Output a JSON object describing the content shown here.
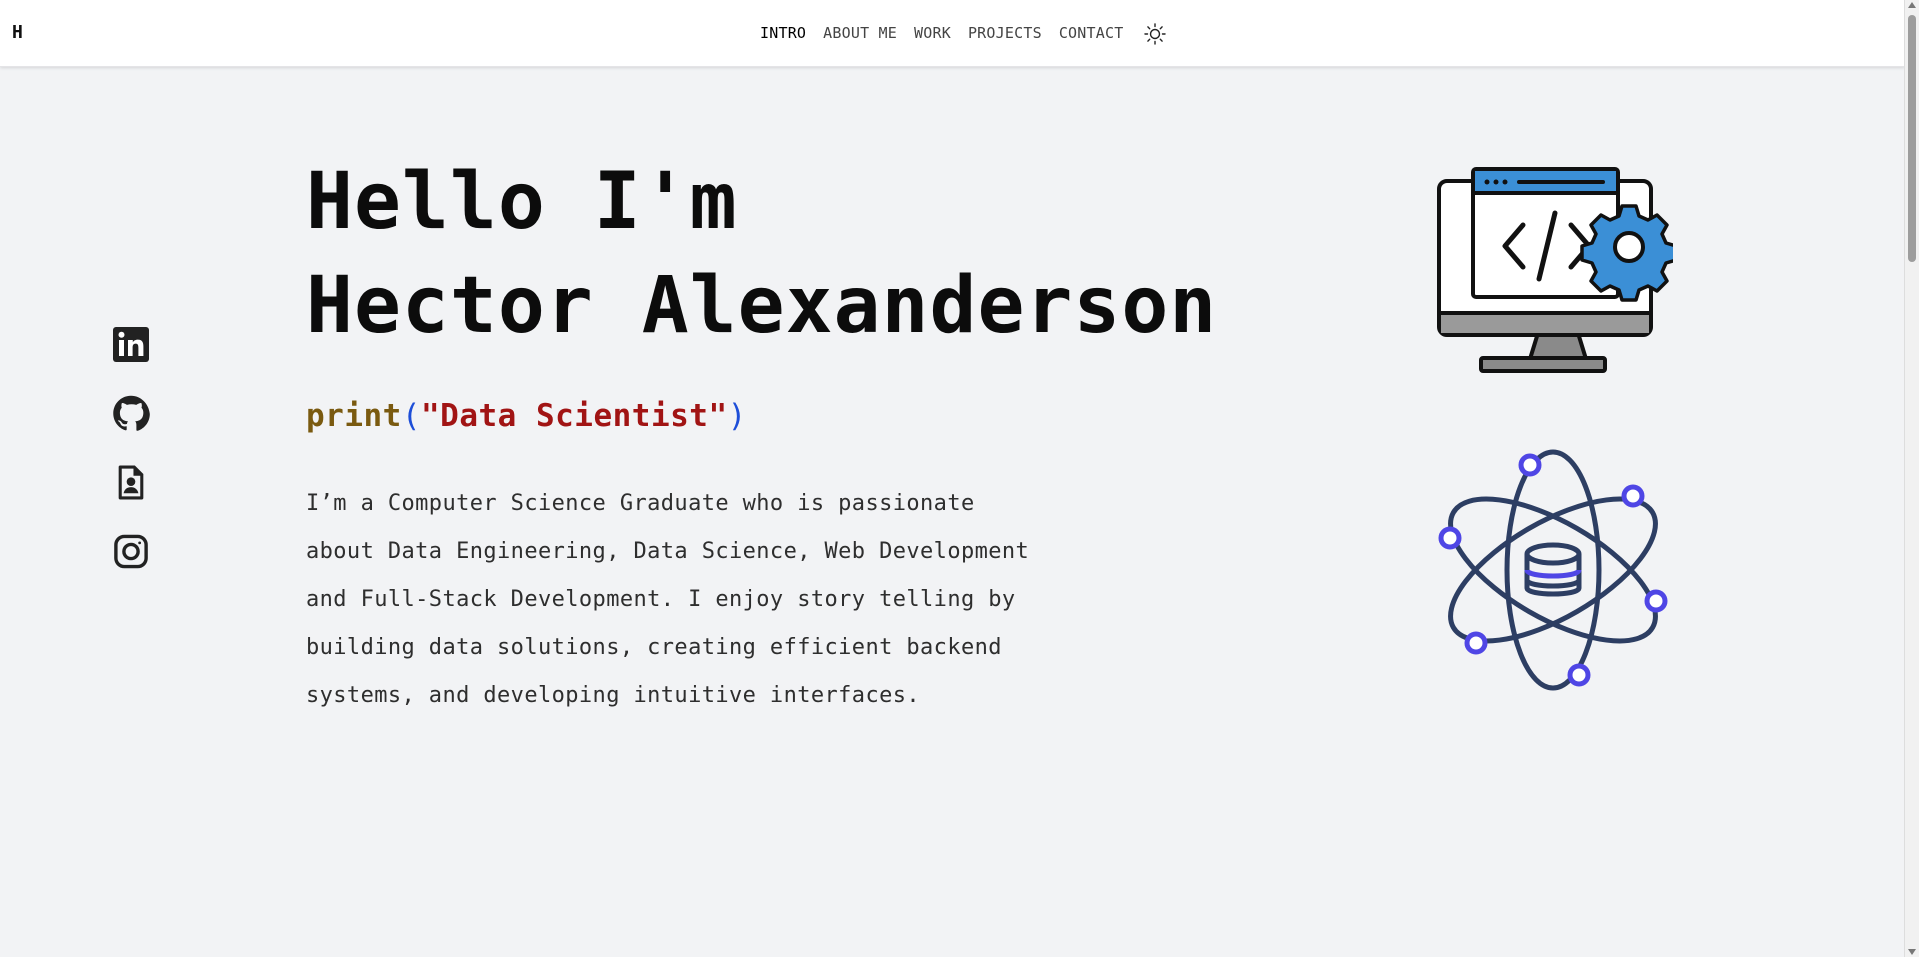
{
  "navbar": {
    "logo": "H",
    "links": [
      {
        "label": "INTRO",
        "active": true
      },
      {
        "label": "ABOUT ME",
        "active": false
      },
      {
        "label": "WORK",
        "active": false
      },
      {
        "label": "PROJECTS",
        "active": false
      },
      {
        "label": "CONTACT",
        "active": false
      }
    ],
    "theme_toggle_icon": "sun-icon"
  },
  "socials": [
    {
      "name": "linkedin",
      "icon": "linkedin-icon"
    },
    {
      "name": "github",
      "icon": "github-icon"
    },
    {
      "name": "resume",
      "icon": "resume-document-icon"
    },
    {
      "name": "instagram",
      "icon": "instagram-icon"
    }
  ],
  "hero": {
    "title_line1": "Hello I'm",
    "title_line2": "Hector Alexanderson",
    "code_fn": "print",
    "code_open": "(",
    "code_string": "\"Data Scientist\"",
    "code_close": ")",
    "bio_lines": [
      "I’m a Computer Science Graduate who is passionate",
      "about Data Engineering, Data Science, Web Development",
      "and Full-Stack Development. I enjoy story telling by",
      "building data solutions, creating efficient backend",
      "systems, and developing intuitive interfaces."
    ]
  },
  "illustrations": {
    "monitor": "monitor-code-gear-icon",
    "atom": "atom-database-icon"
  },
  "colors": {
    "background": "#f2f3f5",
    "code_fn": "#7a5a10",
    "code_paren": "#1d4ed8",
    "code_string": "#a11414",
    "accent_blue": "#3b8fd6",
    "atom_orbit": "#2d3e63",
    "atom_node": "#4f46e5"
  }
}
